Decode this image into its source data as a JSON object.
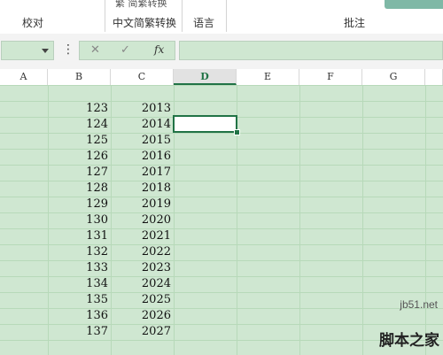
{
  "ribbon": {
    "groups": [
      {
        "label": "校对"
      },
      {
        "label": "中文简繁转换"
      },
      {
        "label": "语言"
      },
      {
        "label": "批注"
      }
    ],
    "partial_top_text": "繁 简繁转换"
  },
  "formula_bar": {
    "name_box_value": "",
    "more_symbol": "⋮",
    "cancel_symbol": "✕",
    "enter_symbol": "✓",
    "fx_label": "fx",
    "formula_value": ""
  },
  "sheet": {
    "columns": [
      "A",
      "B",
      "C",
      "D",
      "E",
      "F",
      "G"
    ],
    "active_column": "D",
    "rows": [
      {
        "b": "123",
        "c": "2013"
      },
      {
        "b": "124",
        "c": "2014"
      },
      {
        "b": "125",
        "c": "2015"
      },
      {
        "b": "126",
        "c": "2016"
      },
      {
        "b": "127",
        "c": "2017"
      },
      {
        "b": "128",
        "c": "2018"
      },
      {
        "b": "129",
        "c": "2019"
      },
      {
        "b": "130",
        "c": "2020"
      },
      {
        "b": "131",
        "c": "2021"
      },
      {
        "b": "132",
        "c": "2022"
      },
      {
        "b": "133",
        "c": "2023"
      },
      {
        "b": "134",
        "c": "2024"
      },
      {
        "b": "135",
        "c": "2025"
      },
      {
        "b": "136",
        "c": "2026"
      },
      {
        "b": "137",
        "c": "2027"
      }
    ],
    "colors": {
      "cell_background": "#cfe7d1",
      "selection": "#217346",
      "gridline": "#b7d9b9"
    }
  },
  "watermark": {
    "url": "jb51.net",
    "text": "脚本之家"
  }
}
